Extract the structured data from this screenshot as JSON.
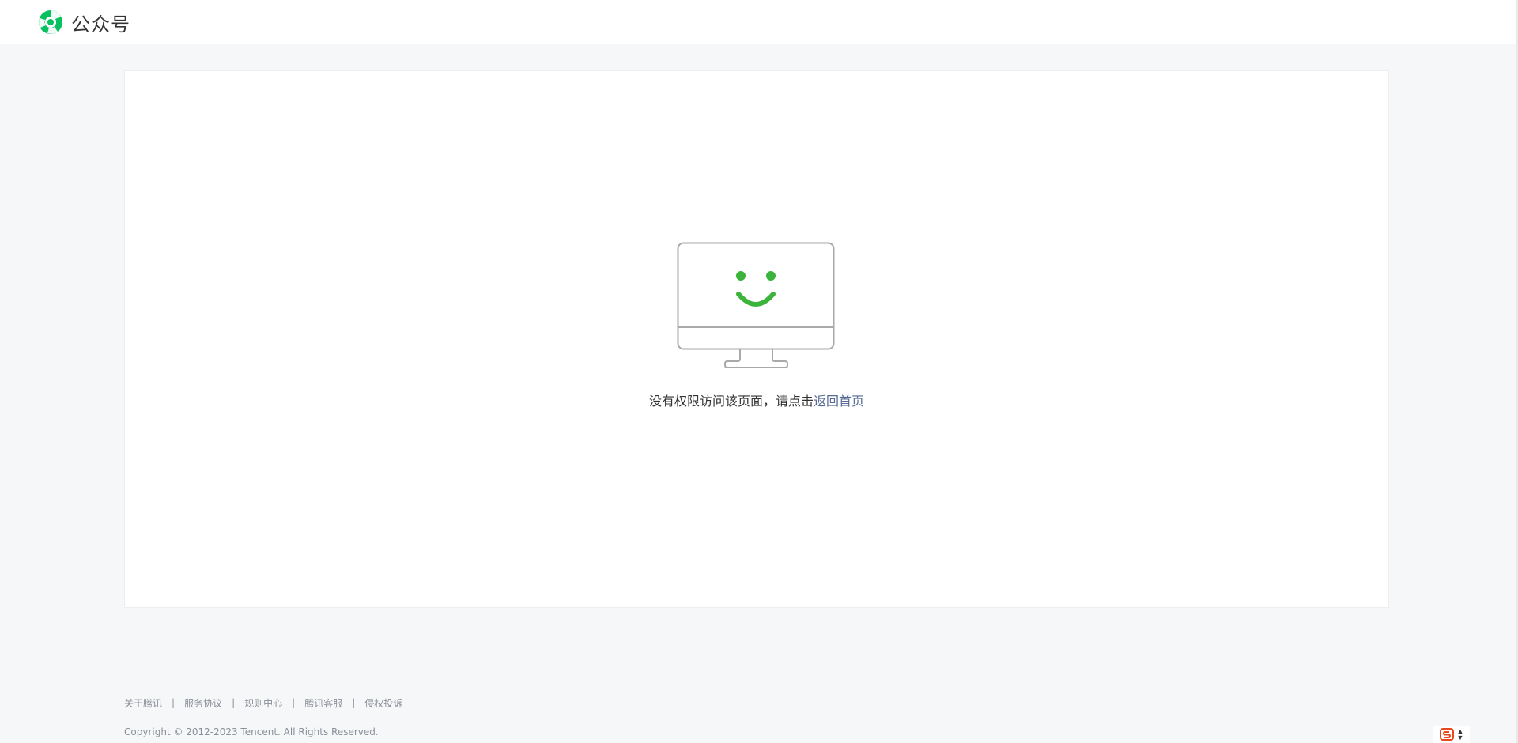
{
  "header": {
    "logo_text": "公众号",
    "logo_color": "#07c160"
  },
  "error": {
    "message": "没有权限访问该页面，请点击",
    "link_label": "返回首页",
    "illustration": "monitor-smile-icon",
    "smile_color": "#3cb43c"
  },
  "footer": {
    "links": [
      "关于腾讯",
      "服务协议",
      "规则中心",
      "腾讯客服",
      "侵权投诉"
    ],
    "separator": "|",
    "copyright": "Copyright © 2012-2023 Tencent. All Rights Reserved."
  },
  "ime": {
    "icon": "sogou-ime-icon",
    "arrows": [
      "▲",
      "▼"
    ]
  },
  "colors": {
    "page_bg": "#f6f7f8",
    "link": "#576b95",
    "brand_green": "#07c160"
  }
}
